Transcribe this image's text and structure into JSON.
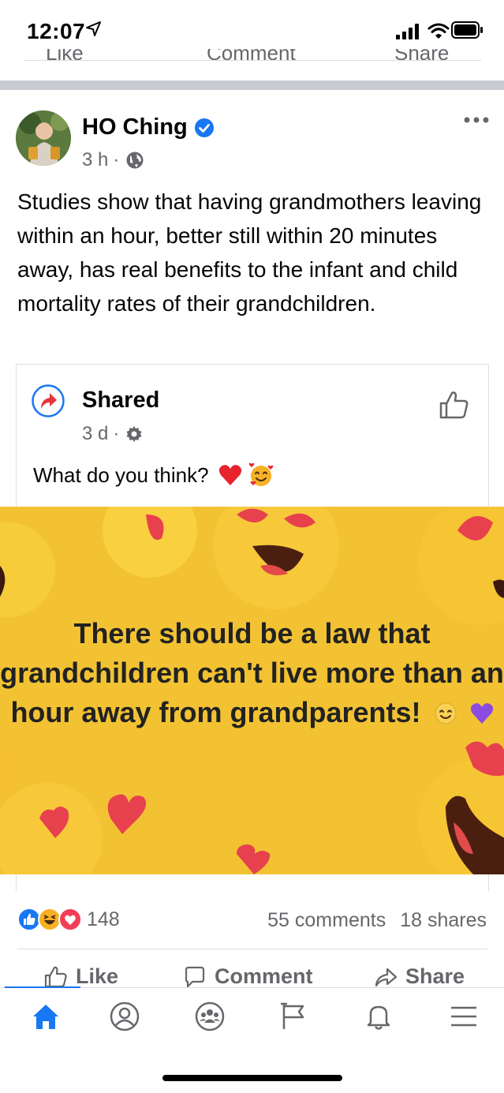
{
  "status_bar": {
    "time": "12:07"
  },
  "previous_post_actions": {
    "like": "Like",
    "comment": "Comment",
    "share": "Share"
  },
  "post": {
    "author": "HO Ching",
    "time": "3 h",
    "separator": "·",
    "text": "Studies show that having grandmothers leaving within an hour, better still within 20 minutes away, has real benefits to the infant and child mortality rates of their grandchildren.",
    "shared": {
      "name": "Shared",
      "time": "3 d",
      "separator": "·",
      "text": "What do you think?",
      "image_text": "There should be a law that grandchildren can't live more than an hour away from grandparents!"
    },
    "reactions": {
      "count": "148",
      "types": [
        "like",
        "haha",
        "love"
      ]
    },
    "stats": {
      "comments": "55 comments",
      "shares": "18 shares"
    },
    "actions": {
      "like": "Like",
      "comment": "Comment",
      "share": "Share"
    }
  },
  "bottom_nav": [
    "home-icon",
    "profile-icon",
    "groups-icon",
    "pages-icon",
    "notifications-icon",
    "menu-icon"
  ],
  "colors": {
    "accent": "#1877f2",
    "meme_background": "#f2c233",
    "love": "#f33e58",
    "haha": "#f7b125"
  }
}
